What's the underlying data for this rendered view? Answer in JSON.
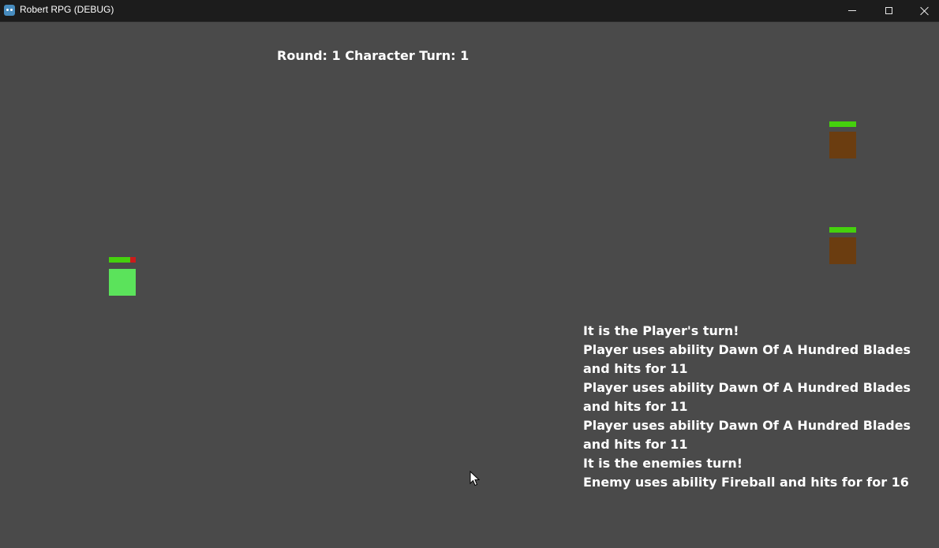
{
  "window": {
    "title": "Robert RPG (DEBUG)",
    "icon": "godot-engine-icon",
    "controls": [
      "minimize-icon",
      "maximize-icon",
      "close-icon"
    ]
  },
  "hud": {
    "round_label": "Round: 1 Character Turn: 1"
  },
  "player": {
    "hp_fraction": 0.8,
    "body_color": "#5be35b"
  },
  "enemies": [
    {
      "hp_fraction": 1.0,
      "body_color": "#6b3d10"
    },
    {
      "hp_fraction": 1.0,
      "body_color": "#6b3d10"
    }
  ],
  "colors": {
    "background": "#4a4a4a",
    "titlebar": "#1c1c1c",
    "hp_fill": "#45d10d",
    "hp_missing": "#cc1b1b",
    "text": "#ffffff"
  },
  "combat_log": [
    "It is the Player's turn!",
    "Player uses ability Dawn Of A Hundred Blades and hits for 11",
    "Player uses ability Dawn Of A Hundred Blades and hits for 11",
    "Player uses ability Dawn Of A Hundred Blades and hits for 11",
    "It is the enemies turn!",
    "Enemy uses ability Fireball and hits for for 16"
  ]
}
